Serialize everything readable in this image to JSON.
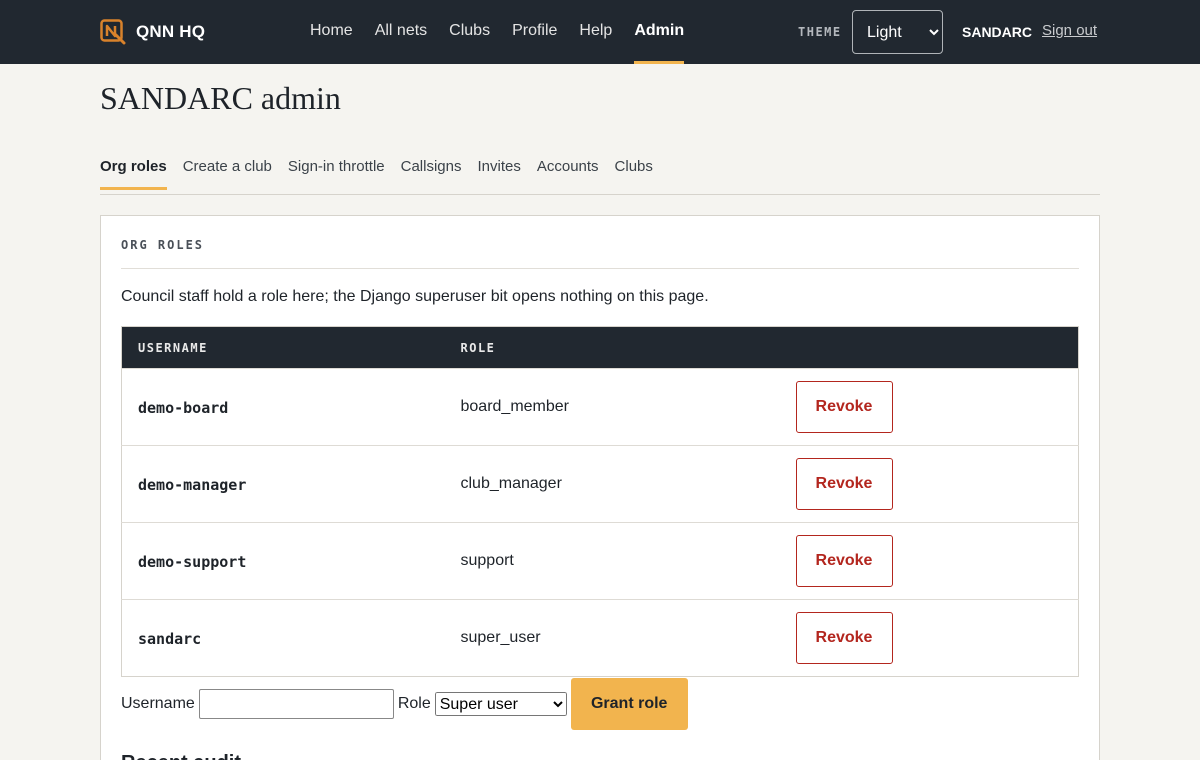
{
  "header": {
    "brand": "QNN HQ",
    "nav": [
      "Home",
      "All nets",
      "Clubs",
      "Profile",
      "Help",
      "Admin"
    ],
    "active_nav": "Admin",
    "theme_label": "THEME",
    "theme_value": "Light",
    "user": "SANDARC",
    "signout": "Sign out",
    "accent_color": "#f2b44e",
    "bar_color": "#212830"
  },
  "page": {
    "title": "SANDARC admin",
    "tabs": [
      "Org roles",
      "Create a club",
      "Sign-in throttle",
      "Callsigns",
      "Invites",
      "Accounts",
      "Clubs"
    ],
    "active_tab": "Org roles"
  },
  "org_roles": {
    "section_title": "ORG ROLES",
    "description": "Council staff hold a role here; the Django superuser bit opens nothing on this page.",
    "columns": [
      "USERNAME",
      "ROLE"
    ],
    "rows": [
      {
        "username": "demo-board",
        "role": "board_member",
        "action": "Revoke"
      },
      {
        "username": "demo-manager",
        "role": "club_manager",
        "action": "Revoke"
      },
      {
        "username": "demo-support",
        "role": "support",
        "action": "Revoke"
      },
      {
        "username": "sandarc",
        "role": "super_user",
        "action": "Revoke"
      }
    ],
    "form": {
      "username_label": "Username",
      "username_value": "",
      "role_label": "Role",
      "role_value": "Super user",
      "submit": "Grant role"
    },
    "next_heading": "Recent audit"
  }
}
